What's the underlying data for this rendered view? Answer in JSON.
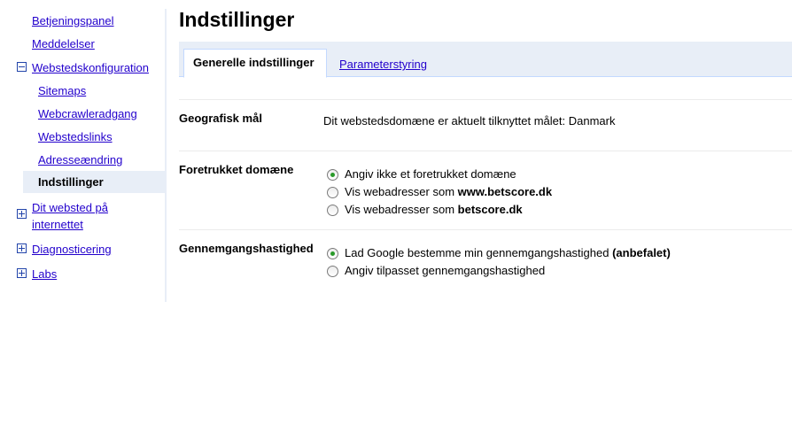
{
  "sidebar": {
    "items": [
      {
        "label": "Betjeningspanel"
      },
      {
        "label": "Meddelelser"
      },
      {
        "label": "Webstedskonfiguration"
      },
      {
        "label": "Sitemaps"
      },
      {
        "label": "Webcrawleradgang"
      },
      {
        "label": "Webstedslinks"
      },
      {
        "label": "Adresseændring"
      },
      {
        "label": "Indstillinger"
      },
      {
        "label_line1": "Dit websted på",
        "label_line2": "internettet"
      },
      {
        "label": "Diagnosticering"
      },
      {
        "label": "Labs"
      }
    ]
  },
  "page": {
    "title": "Indstillinger"
  },
  "tabs": [
    {
      "label": "Generelle indstillinger",
      "active": true
    },
    {
      "label": "Parameterstyring",
      "active": false
    }
  ],
  "sections": {
    "geo": {
      "label": "Geografisk mål",
      "value": "Dit webstedsdomæne er aktuelt tilknyttet målet: Danmark"
    },
    "domain": {
      "label": "Foretrukket domæne",
      "options": [
        {
          "text": "Angiv ikke et foretrukket domæne",
          "bold": "",
          "checked": true
        },
        {
          "text": "Vis webadresser som ",
          "bold": "www.betscore.dk",
          "checked": false
        },
        {
          "text": "Vis webadresser som ",
          "bold": "betscore.dk",
          "checked": false
        }
      ]
    },
    "crawl": {
      "label": "Gennemgangshastighed",
      "options": [
        {
          "text": "Lad Google bestemme min gennemgangshastighed ",
          "bold": "(anbefalet)",
          "checked": true
        },
        {
          "text": "Angiv tilpasset gennemgangshastighed",
          "bold": "",
          "checked": false
        }
      ]
    }
  },
  "colors": {
    "link": "#2200cc",
    "tab_bg": "#e8eef7",
    "radio_checked": "#2a9a2a"
  }
}
